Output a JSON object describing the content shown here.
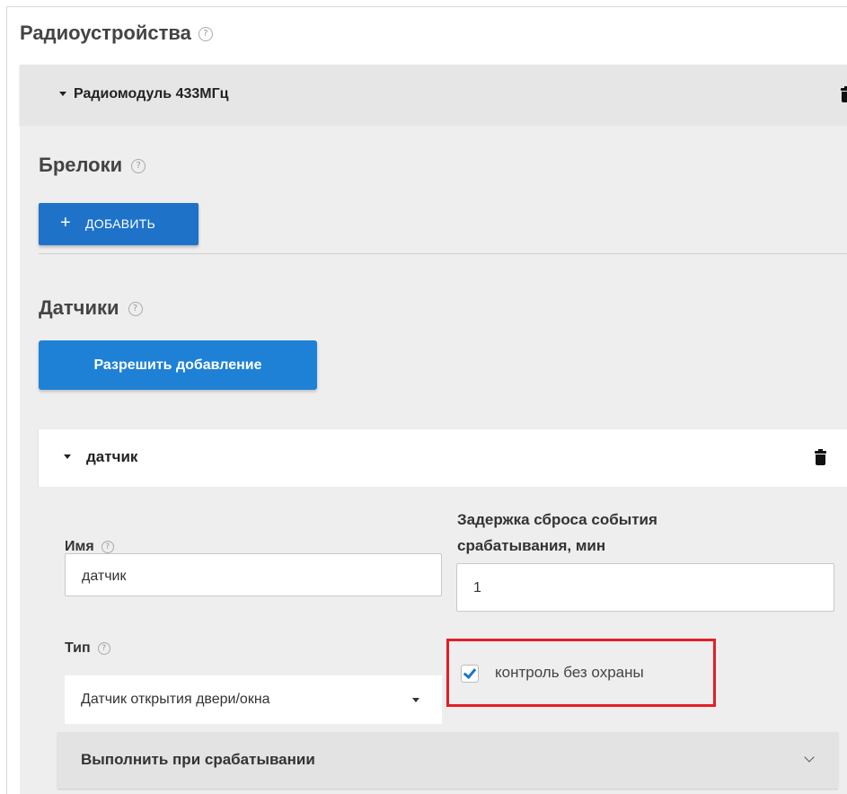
{
  "page": {
    "title": "Радиоустройства",
    "help_glyph": "?"
  },
  "radio_module": {
    "title": "Радиомодуль 433МГц"
  },
  "keyfobs": {
    "title": "Брелоки",
    "add_button": {
      "icon": "+",
      "label": "ДОБАВИТЬ"
    }
  },
  "sensors": {
    "title": "Датчики",
    "allow_button": "Разрешить добавление"
  },
  "sensor": {
    "title": "датчик",
    "name_label": "Имя",
    "name_value": "датчик",
    "delay_label": "Задержка сброса события срабатывания, мин",
    "delay_value": "1",
    "type_label": "Тип",
    "type_value": "Датчик открытия двери/окна",
    "control_checkbox": {
      "label": "контроль без охраны",
      "checked": true
    },
    "action_section": "Выполнить при срабатывании"
  },
  "colors": {
    "primary": "#1e73c9",
    "highlight": "#e41e26",
    "panel": "#eeeeee"
  }
}
